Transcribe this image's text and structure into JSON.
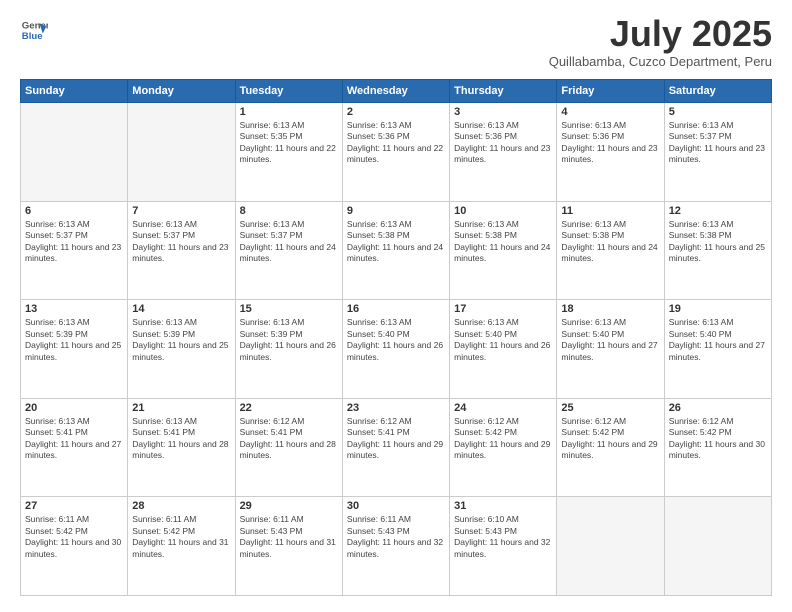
{
  "header": {
    "logo_line1": "General",
    "logo_line2": "Blue",
    "month": "July 2025",
    "location": "Quillabamba, Cuzco Department, Peru"
  },
  "weekdays": [
    "Sunday",
    "Monday",
    "Tuesday",
    "Wednesday",
    "Thursday",
    "Friday",
    "Saturday"
  ],
  "weeks": [
    [
      {
        "day": "",
        "info": ""
      },
      {
        "day": "",
        "info": ""
      },
      {
        "day": "1",
        "info": "Sunrise: 6:13 AM\nSunset: 5:35 PM\nDaylight: 11 hours and 22 minutes."
      },
      {
        "day": "2",
        "info": "Sunrise: 6:13 AM\nSunset: 5:36 PM\nDaylight: 11 hours and 22 minutes."
      },
      {
        "day": "3",
        "info": "Sunrise: 6:13 AM\nSunset: 5:36 PM\nDaylight: 11 hours and 23 minutes."
      },
      {
        "day": "4",
        "info": "Sunrise: 6:13 AM\nSunset: 5:36 PM\nDaylight: 11 hours and 23 minutes."
      },
      {
        "day": "5",
        "info": "Sunrise: 6:13 AM\nSunset: 5:37 PM\nDaylight: 11 hours and 23 minutes."
      }
    ],
    [
      {
        "day": "6",
        "info": "Sunrise: 6:13 AM\nSunset: 5:37 PM\nDaylight: 11 hours and 23 minutes."
      },
      {
        "day": "7",
        "info": "Sunrise: 6:13 AM\nSunset: 5:37 PM\nDaylight: 11 hours and 23 minutes."
      },
      {
        "day": "8",
        "info": "Sunrise: 6:13 AM\nSunset: 5:37 PM\nDaylight: 11 hours and 24 minutes."
      },
      {
        "day": "9",
        "info": "Sunrise: 6:13 AM\nSunset: 5:38 PM\nDaylight: 11 hours and 24 minutes."
      },
      {
        "day": "10",
        "info": "Sunrise: 6:13 AM\nSunset: 5:38 PM\nDaylight: 11 hours and 24 minutes."
      },
      {
        "day": "11",
        "info": "Sunrise: 6:13 AM\nSunset: 5:38 PM\nDaylight: 11 hours and 24 minutes."
      },
      {
        "day": "12",
        "info": "Sunrise: 6:13 AM\nSunset: 5:38 PM\nDaylight: 11 hours and 25 minutes."
      }
    ],
    [
      {
        "day": "13",
        "info": "Sunrise: 6:13 AM\nSunset: 5:39 PM\nDaylight: 11 hours and 25 minutes."
      },
      {
        "day": "14",
        "info": "Sunrise: 6:13 AM\nSunset: 5:39 PM\nDaylight: 11 hours and 25 minutes."
      },
      {
        "day": "15",
        "info": "Sunrise: 6:13 AM\nSunset: 5:39 PM\nDaylight: 11 hours and 26 minutes."
      },
      {
        "day": "16",
        "info": "Sunrise: 6:13 AM\nSunset: 5:40 PM\nDaylight: 11 hours and 26 minutes."
      },
      {
        "day": "17",
        "info": "Sunrise: 6:13 AM\nSunset: 5:40 PM\nDaylight: 11 hours and 26 minutes."
      },
      {
        "day": "18",
        "info": "Sunrise: 6:13 AM\nSunset: 5:40 PM\nDaylight: 11 hours and 27 minutes."
      },
      {
        "day": "19",
        "info": "Sunrise: 6:13 AM\nSunset: 5:40 PM\nDaylight: 11 hours and 27 minutes."
      }
    ],
    [
      {
        "day": "20",
        "info": "Sunrise: 6:13 AM\nSunset: 5:41 PM\nDaylight: 11 hours and 27 minutes."
      },
      {
        "day": "21",
        "info": "Sunrise: 6:13 AM\nSunset: 5:41 PM\nDaylight: 11 hours and 28 minutes."
      },
      {
        "day": "22",
        "info": "Sunrise: 6:12 AM\nSunset: 5:41 PM\nDaylight: 11 hours and 28 minutes."
      },
      {
        "day": "23",
        "info": "Sunrise: 6:12 AM\nSunset: 5:41 PM\nDaylight: 11 hours and 29 minutes."
      },
      {
        "day": "24",
        "info": "Sunrise: 6:12 AM\nSunset: 5:42 PM\nDaylight: 11 hours and 29 minutes."
      },
      {
        "day": "25",
        "info": "Sunrise: 6:12 AM\nSunset: 5:42 PM\nDaylight: 11 hours and 29 minutes."
      },
      {
        "day": "26",
        "info": "Sunrise: 6:12 AM\nSunset: 5:42 PM\nDaylight: 11 hours and 30 minutes."
      }
    ],
    [
      {
        "day": "27",
        "info": "Sunrise: 6:11 AM\nSunset: 5:42 PM\nDaylight: 11 hours and 30 minutes."
      },
      {
        "day": "28",
        "info": "Sunrise: 6:11 AM\nSunset: 5:42 PM\nDaylight: 11 hours and 31 minutes."
      },
      {
        "day": "29",
        "info": "Sunrise: 6:11 AM\nSunset: 5:43 PM\nDaylight: 11 hours and 31 minutes."
      },
      {
        "day": "30",
        "info": "Sunrise: 6:11 AM\nSunset: 5:43 PM\nDaylight: 11 hours and 32 minutes."
      },
      {
        "day": "31",
        "info": "Sunrise: 6:10 AM\nSunset: 5:43 PM\nDaylight: 11 hours and 32 minutes."
      },
      {
        "day": "",
        "info": ""
      },
      {
        "day": "",
        "info": ""
      }
    ]
  ]
}
